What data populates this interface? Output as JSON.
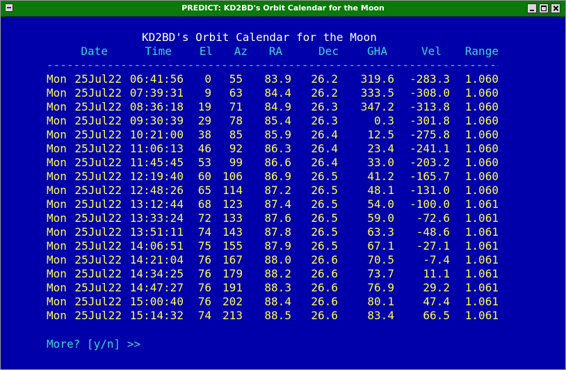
{
  "window": {
    "title": "PREDICT: KD2BD's Orbit Calendar for the Moon"
  },
  "terminal": {
    "heading": "KD2BD's Orbit Calendar for the Moon",
    "columns": [
      "Date",
      "Time",
      "El",
      "Az",
      "RA",
      "Dec",
      "GHA",
      "Vel",
      "Range"
    ],
    "separator": "---------------------------------------------------------------------------------",
    "rows": [
      [
        "Mon",
        "25Jul22",
        "06:41:56",
        "0",
        "55",
        "83.9",
        "26.2",
        "319.6",
        "-283.3",
        "1.060"
      ],
      [
        "Mon",
        "25Jul22",
        "07:39:31",
        "9",
        "63",
        "84.4",
        "26.2",
        "333.5",
        "-308.0",
        "1.060"
      ],
      [
        "Mon",
        "25Jul22",
        "08:36:18",
        "19",
        "71",
        "84.9",
        "26.3",
        "347.2",
        "-313.8",
        "1.060"
      ],
      [
        "Mon",
        "25Jul22",
        "09:30:39",
        "29",
        "78",
        "85.4",
        "26.3",
        "0.3",
        "-301.8",
        "1.060"
      ],
      [
        "Mon",
        "25Jul22",
        "10:21:00",
        "38",
        "85",
        "85.9",
        "26.4",
        "12.5",
        "-275.8",
        "1.060"
      ],
      [
        "Mon",
        "25Jul22",
        "11:06:13",
        "46",
        "92",
        "86.3",
        "26.4",
        "23.4",
        "-241.1",
        "1.060"
      ],
      [
        "Mon",
        "25Jul22",
        "11:45:45",
        "53",
        "99",
        "86.6",
        "26.4",
        "33.0",
        "-203.2",
        "1.060"
      ],
      [
        "Mon",
        "25Jul22",
        "12:19:40",
        "60",
        "106",
        "86.9",
        "26.5",
        "41.2",
        "-165.7",
        "1.060"
      ],
      [
        "Mon",
        "25Jul22",
        "12:48:26",
        "65",
        "114",
        "87.2",
        "26.5",
        "48.1",
        "-131.0",
        "1.060"
      ],
      [
        "Mon",
        "25Jul22",
        "13:12:44",
        "68",
        "123",
        "87.4",
        "26.5",
        "54.0",
        "-100.0",
        "1.061"
      ],
      [
        "Mon",
        "25Jul22",
        "13:33:24",
        "72",
        "133",
        "87.6",
        "26.5",
        "59.0",
        "-72.6",
        "1.061"
      ],
      [
        "Mon",
        "25Jul22",
        "13:51:11",
        "74",
        "143",
        "87.8",
        "26.5",
        "63.3",
        "-48.6",
        "1.061"
      ],
      [
        "Mon",
        "25Jul22",
        "14:06:51",
        "75",
        "155",
        "87.9",
        "26.5",
        "67.1",
        "-27.1",
        "1.061"
      ],
      [
        "Mon",
        "25Jul22",
        "14:21:04",
        "76",
        "167",
        "88.0",
        "26.6",
        "70.5",
        "-7.4",
        "1.061"
      ],
      [
        "Mon",
        "25Jul22",
        "14:34:25",
        "76",
        "179",
        "88.2",
        "26.6",
        "73.7",
        "11.1",
        "1.061"
      ],
      [
        "Mon",
        "25Jul22",
        "14:47:27",
        "76",
        "191",
        "88.3",
        "26.6",
        "76.9",
        "29.2",
        "1.061"
      ],
      [
        "Mon",
        "25Jul22",
        "15:00:40",
        "76",
        "202",
        "88.4",
        "26.6",
        "80.1",
        "47.4",
        "1.061"
      ],
      [
        "Mon",
        "25Jul22",
        "15:14:32",
        "74",
        "213",
        "88.5",
        "26.6",
        "83.4",
        "66.5",
        "1.061"
      ]
    ],
    "prompt": "More? [y/n] >>"
  },
  "colors": {
    "title_bar": "#0a7a0a",
    "terminal_bg": "#0000aa",
    "data_text": "#ffff55",
    "header_text": "#3cd7d7",
    "heading_text": "#ffffff"
  }
}
